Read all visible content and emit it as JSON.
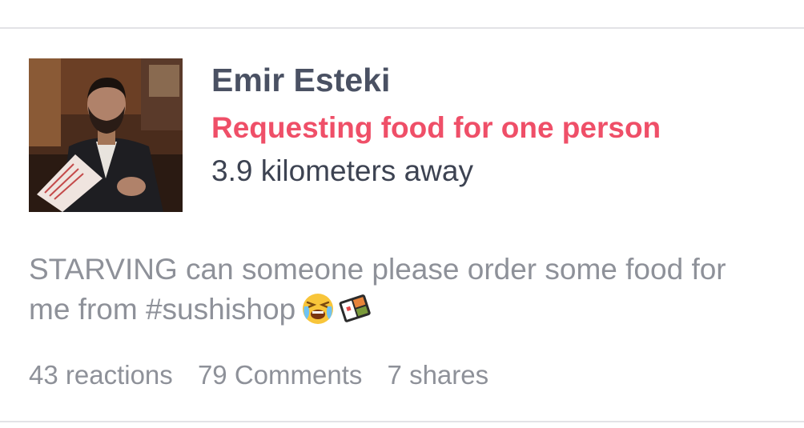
{
  "post": {
    "user_name": "Emir Esteki",
    "request_text": "Requesting food for one person",
    "distance_text": "3.9 kilometers away",
    "body_line_1": "STARVING can someone please order some food for",
    "body_line_2": "me from #sushishop",
    "emojis": [
      "crying-face-emoji",
      "bento-box-emoji"
    ],
    "stats": {
      "reactions": "43 reactions",
      "comments": "79 Comments",
      "shares": "7 shares"
    }
  },
  "colors": {
    "name": "#4a5163",
    "request_accent": "#ef4f68",
    "muted_text": "#8e9199",
    "divider": "#e3e3e6"
  }
}
